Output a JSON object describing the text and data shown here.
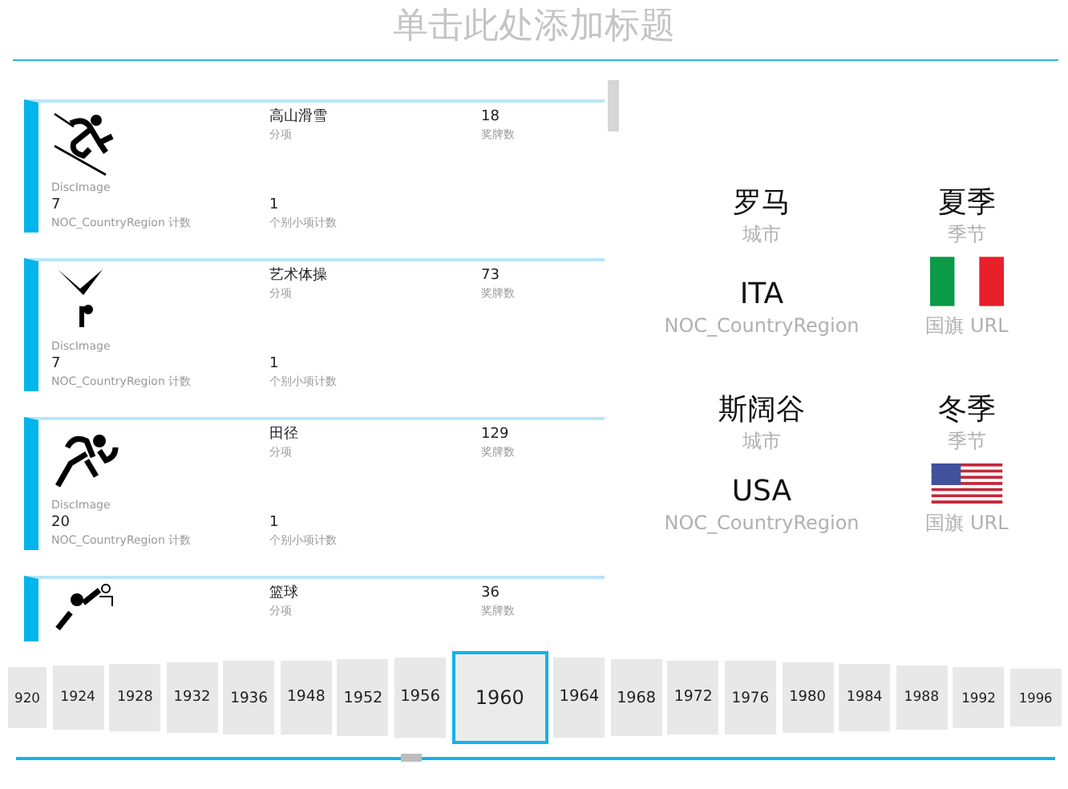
{
  "title": "单击此处添加标题",
  "disciplines": [
    {
      "image_label": "DiscImage",
      "discipline": "高山滑雪",
      "discipline_label": "分项",
      "medals": "18",
      "medals_label": "奖牌数",
      "noc_count": "7",
      "noc_count_label": "NOC_CountryRegion 计数",
      "event_count": "1",
      "event_count_label": "个别小项计数"
    },
    {
      "image_label": "DiscImage",
      "discipline": "艺术体操",
      "discipline_label": "分项",
      "medals": "73",
      "medals_label": "奖牌数",
      "noc_count": "7",
      "noc_count_label": "NOC_CountryRegion 计数",
      "event_count": "1",
      "event_count_label": "个别小项计数"
    },
    {
      "image_label": "DiscImage",
      "discipline": "田径",
      "discipline_label": "分项",
      "medals": "129",
      "medals_label": "奖牌数",
      "noc_count": "20",
      "noc_count_label": "NOC_CountryRegion 计数",
      "event_count": "1",
      "event_count_label": "个别小项计数"
    },
    {
      "discipline": "篮球",
      "discipline_label": "分项",
      "medals": "36",
      "medals_label": "奖牌数"
    }
  ],
  "hosts": [
    {
      "city": "罗马",
      "city_label": "城市",
      "season": "夏季",
      "season_label": "季节",
      "noc": "ITA",
      "noc_label": "NOC_CountryRegion",
      "flag_label": "国旗 URL"
    },
    {
      "city": "斯阔谷",
      "city_label": "城市",
      "season": "冬季",
      "season_label": "季节",
      "noc": "USA",
      "noc_label": "NOC_CountryRegion",
      "flag_label": "国旗 URL"
    }
  ],
  "years": [
    {
      "label": "920",
      "selected": false
    },
    {
      "label": "1924",
      "selected": false
    },
    {
      "label": "1928",
      "selected": false
    },
    {
      "label": "1932",
      "selected": false
    },
    {
      "label": "1936",
      "selected": false
    },
    {
      "label": "1948",
      "selected": false
    },
    {
      "label": "1952",
      "selected": false
    },
    {
      "label": "1956",
      "selected": false
    },
    {
      "label": "1960",
      "selected": true
    },
    {
      "label": "1964",
      "selected": false
    },
    {
      "label": "1968",
      "selected": false
    },
    {
      "label": "1972",
      "selected": false
    },
    {
      "label": "1976",
      "selected": false
    },
    {
      "label": "1980",
      "selected": false
    },
    {
      "label": "1984",
      "selected": false
    },
    {
      "label": "1988",
      "selected": false
    },
    {
      "label": "1992",
      "selected": false
    },
    {
      "label": "1996",
      "selected": false
    }
  ]
}
